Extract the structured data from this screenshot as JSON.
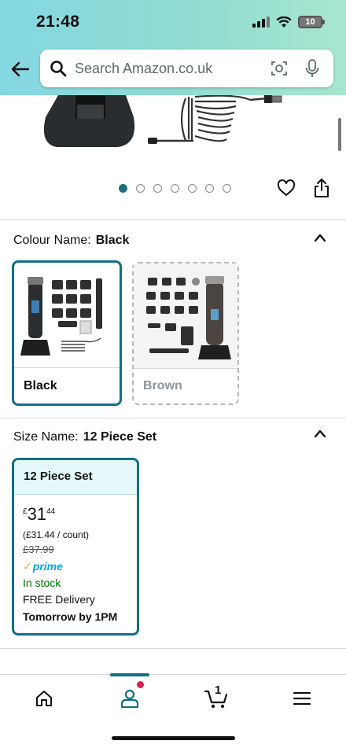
{
  "status_bar": {
    "time": "21:48",
    "battery": "10"
  },
  "search": {
    "placeholder": "Search Amazon.co.uk"
  },
  "carousel": {
    "count": 7,
    "active_index": 0
  },
  "colour": {
    "label": "Colour Name:",
    "selected": "Black",
    "options": [
      {
        "name": "Black"
      },
      {
        "name": "Brown"
      }
    ]
  },
  "size": {
    "label": "Size Name:",
    "selected": "12 Piece Set",
    "card": {
      "title": "12 Piece Set",
      "currency": "£",
      "price_whole": "31",
      "price_fraction": "44",
      "per_count": "(£31.44 / count)",
      "old_price": "£37.99",
      "prime": "prime",
      "stock": "In stock",
      "delivery": "FREE Delivery",
      "delivery_time": "Tomorrow by 1PM"
    }
  },
  "bottom_nav": {
    "cart_count": "1"
  },
  "colors": {
    "accent": "#127083",
    "stock": "#007600",
    "prime": "#00a8e1"
  }
}
